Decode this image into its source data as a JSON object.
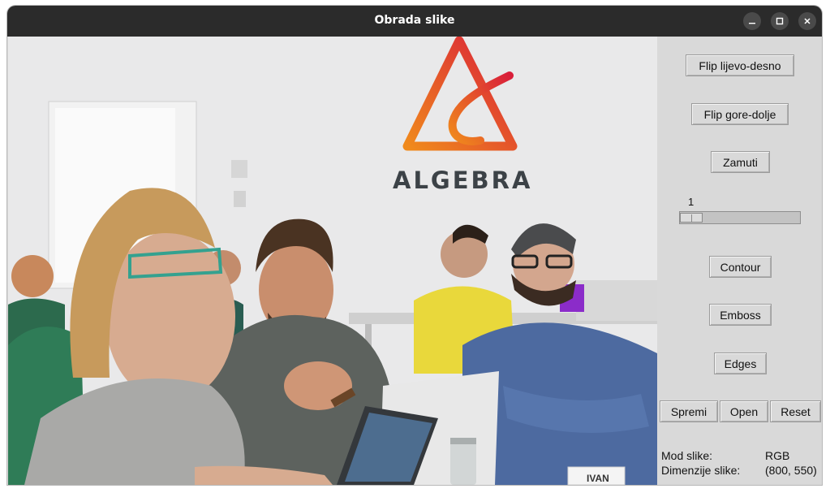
{
  "window": {
    "title": "Obrada slike"
  },
  "photo": {
    "logo_text": "ALGEBRA",
    "badge_text": "IVAN",
    "colors": {
      "logo_gradient_start": "#f08a1c",
      "logo_gradient_end": "#d91f3a",
      "wall": "#e9e9ea"
    }
  },
  "controls": {
    "flip_lr": "Flip lijevo-desno",
    "flip_ud": "Flip gore-dolje",
    "blur": "Zamuti",
    "blur_slider": {
      "value": "1",
      "fraction": 0.0
    },
    "contour": "Contour",
    "emboss": "Emboss",
    "edges": "Edges",
    "save": "Spremi",
    "open": "Open",
    "reset": "Reset"
  },
  "info": {
    "mode_label": "Mod slike:",
    "mode_value": "RGB",
    "dims_label": "Dimenzije slike:",
    "dims_value": "(800, 550)"
  }
}
